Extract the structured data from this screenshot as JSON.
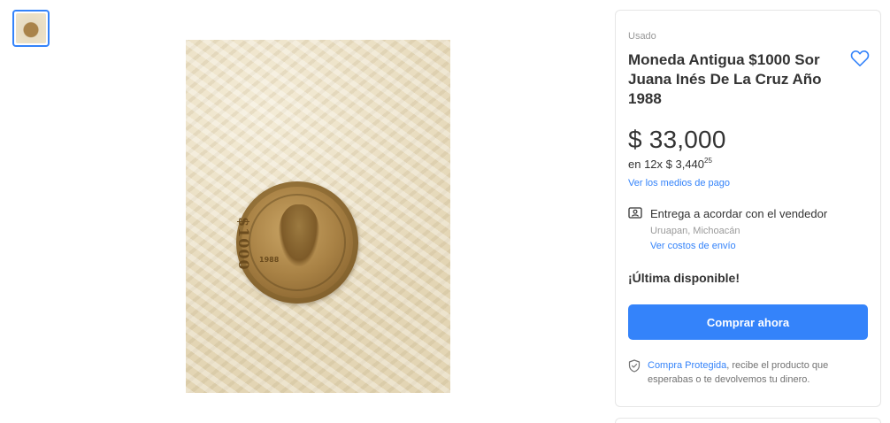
{
  "gallery": {
    "thumbnail_count": 1
  },
  "product": {
    "condition": "Usado",
    "title": "Moneda Antigua $1000 Sor Juana Inés De La Cruz Año 1988",
    "price": "$ 33,000",
    "installments_prefix": "en 12x $ 3,440",
    "installments_cents": "25",
    "payment_link": "Ver los medios de pago"
  },
  "shipping": {
    "title": "Entrega a acordar con el vendedor",
    "location": "Uruapan, Michoacán",
    "costs_link": "Ver costos de envío"
  },
  "stock": {
    "label": "¡Última disponible!"
  },
  "actions": {
    "buy_label": "Comprar ahora"
  },
  "protection": {
    "link": "Compra Protegida",
    "text": ", recibe el producto que esperabas o te devolvemos tu dinero."
  },
  "coin": {
    "value_text": "$1000",
    "year_text": "1988"
  },
  "colors": {
    "accent": "#3483fa",
    "text": "#333333",
    "muted": "#999999"
  },
  "icons": {
    "favorite": "heart-outline-icon",
    "shipping": "person-card-icon",
    "protection": "shield-check-icon"
  }
}
